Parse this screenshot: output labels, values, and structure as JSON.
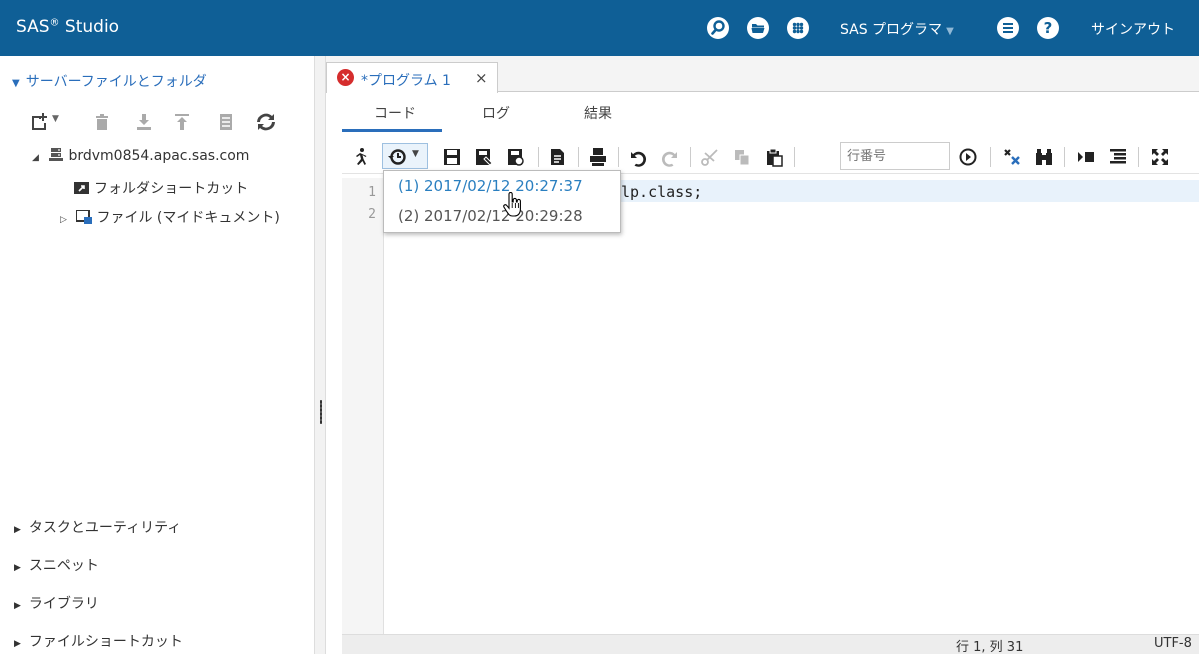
{
  "app": {
    "brand": "SAS",
    "brand_sup": "®",
    "brand_suffix": " Studio",
    "user_menu": "SAS プログラマ",
    "signout": "サインアウト",
    "colors": {
      "header_bg": "#0f5f96",
      "accent": "#2a6ebb",
      "error": "#d52d2d"
    }
  },
  "leftpanel": {
    "server_section": "サーバーファイルとフォルダ",
    "tree": {
      "root": "brdvm0854.apac.sas.com",
      "children": [
        "フォルダショートカット",
        "ファイル (マイドキュメント)"
      ]
    },
    "toolbar_icons": [
      "new-icon",
      "delete-icon",
      "download-icon",
      "upload-icon",
      "properties-icon",
      "refresh-icon"
    ],
    "bottom_sections": [
      "タスクとユーティリティ",
      "スニペット",
      "ライブラリ",
      "ファイルショートカット"
    ]
  },
  "editor": {
    "tab_title": "*プログラム 1",
    "tab_close": "×",
    "subtabs": [
      "コード",
      "ログ",
      "結果"
    ],
    "line_number_placeholder": "行番号",
    "lines": [
      "1",
      "2"
    ],
    "code_line1_visible": "lp.class;",
    "status_position": "行 1, 列 31",
    "status_encoding": "UTF-8"
  },
  "history_dropdown": {
    "items": [
      {
        "label": "(1)  2017/02/12 20:27:37",
        "highlighted": true
      },
      {
        "label": "(2)  2017/02/12 20:29:28",
        "highlighted": false
      }
    ]
  }
}
